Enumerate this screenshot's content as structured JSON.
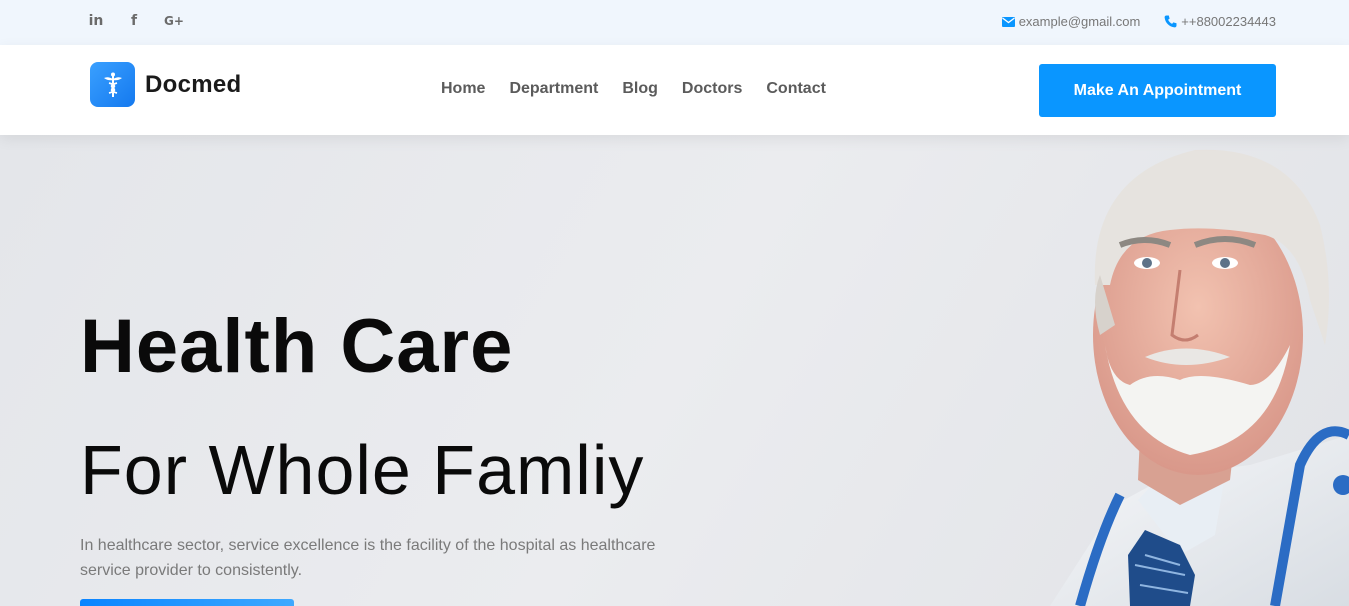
{
  "topbar": {
    "social": [
      {
        "icon": "linkedin-icon",
        "glyph": "in"
      },
      {
        "icon": "facebook-icon",
        "glyph": "f"
      },
      {
        "icon": "google-plus-icon",
        "glyph": "G+"
      }
    ],
    "email": "example@gmail.com",
    "phone": "++88002234443"
  },
  "header": {
    "logo_text": "Docmed",
    "nav": [
      "Home",
      "Department",
      "Blog",
      "Doctors",
      "Contact"
    ],
    "cta": "Make An Appointment"
  },
  "hero": {
    "title": "Health Care",
    "subtitle": "For Whole Famliy",
    "description": "In healthcare sector, service excellence is the facility of the hospital as healthcare service provider to consistently."
  },
  "colors": {
    "accent": "#0a96ff",
    "topbar_bg": "#f0f6fd",
    "hero_bg": "#e9eaee"
  }
}
